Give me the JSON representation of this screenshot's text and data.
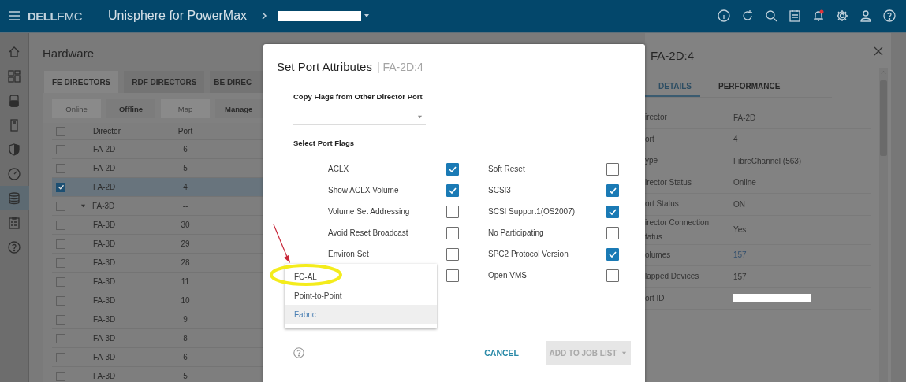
{
  "top_bar": {
    "brand": [
      "DELL",
      "EMC"
    ],
    "app_title": "Unisphere for PowerMax",
    "system_redacted": true
  },
  "sidebar": {
    "items": [
      {
        "selected": false
      },
      {
        "selected": false
      },
      {
        "selected": false
      },
      {
        "selected": false
      },
      {
        "selected": false
      },
      {
        "selected": false
      },
      {
        "selected": true
      },
      {
        "selected": false
      },
      {
        "selected": false
      }
    ]
  },
  "page": {
    "title": "Hardware",
    "tabs": [
      {
        "label": "FE DIRECTORS",
        "selected": true
      },
      {
        "label": "RDF DIRECTORS",
        "selected": false
      },
      {
        "label": "BE DIREC",
        "selected": false
      }
    ],
    "actions": [
      {
        "label": "Online",
        "disabled": true
      },
      {
        "label": "Offline",
        "disabled": false
      },
      {
        "label": "Map",
        "disabled": true
      },
      {
        "label": "Manage",
        "disabled": false
      }
    ],
    "table": {
      "columns": [
        "Director",
        "Port"
      ],
      "header_checked": false,
      "rows": [
        {
          "director": "FA-2D",
          "port": "6",
          "checked": false,
          "selected": false,
          "kind": "child"
        },
        {
          "director": "FA-2D",
          "port": "5",
          "checked": false,
          "selected": false,
          "kind": "child"
        },
        {
          "director": "FA-2D",
          "port": "4",
          "checked": true,
          "selected": true,
          "kind": "child"
        },
        {
          "director": "FA-3D",
          "port": "--",
          "checked": false,
          "selected": false,
          "kind": "group",
          "expanded": true
        },
        {
          "director": "FA-3D",
          "port": "30",
          "checked": false,
          "selected": false,
          "kind": "child"
        },
        {
          "director": "FA-3D",
          "port": "29",
          "checked": false,
          "selected": false,
          "kind": "child"
        },
        {
          "director": "FA-3D",
          "port": "28",
          "checked": false,
          "selected": false,
          "kind": "child"
        },
        {
          "director": "FA-3D",
          "port": "11",
          "checked": false,
          "selected": false,
          "kind": "child"
        },
        {
          "director": "FA-3D",
          "port": "10",
          "checked": false,
          "selected": false,
          "kind": "child"
        },
        {
          "director": "FA-3D",
          "port": "9",
          "checked": false,
          "selected": false,
          "kind": "child"
        },
        {
          "director": "FA-3D",
          "port": "8",
          "checked": false,
          "selected": false,
          "kind": "child"
        },
        {
          "director": "FA-3D",
          "port": "6",
          "checked": false,
          "selected": false,
          "kind": "child"
        },
        {
          "director": "FA-3D",
          "port": "5",
          "checked": false,
          "selected": false,
          "kind": "child"
        }
      ]
    }
  },
  "detail_panel": {
    "title": "FA-2D:4",
    "tabs": [
      {
        "label": "DETAILS",
        "selected": true
      },
      {
        "label": "PERFORMANCE",
        "selected": false
      }
    ],
    "rows": [
      {
        "label": "irector",
        "value": "FA-2D",
        "kind": "text"
      },
      {
        "label": "ort",
        "value": "4",
        "kind": "text"
      },
      {
        "label": "ype",
        "value": "FibreChannel (563)",
        "kind": "text"
      },
      {
        "label": "irector Status",
        "value": "Online",
        "kind": "text"
      },
      {
        "label": "ort Status",
        "value": "ON",
        "kind": "text"
      },
      {
        "label": "irector Connection tatus",
        "value": "Yes",
        "kind": "text"
      },
      {
        "label": "olumes",
        "value": "157",
        "kind": "link"
      },
      {
        "label": "lapped Devices",
        "value": "157",
        "kind": "text"
      },
      {
        "label": "ort ID",
        "kind": "redacted"
      }
    ]
  },
  "dialog": {
    "title": "Set Port Attributes",
    "subtitle": "| FA-2D:4",
    "copy_label": "Copy Flags from Other Director Port",
    "flags_label": "Select Port Flags",
    "flags_left": [
      {
        "label": "ACLX",
        "checked": true
      },
      {
        "label": "Show ACLX Volume",
        "checked": true
      },
      {
        "label": "Volume Set Addressing",
        "checked": false
      },
      {
        "label": "Avoid Reset Broadcast",
        "checked": false
      },
      {
        "label": "Environ Set",
        "checked": false
      },
      {
        "checked": false
      }
    ],
    "flags_right": [
      {
        "label": "Soft Reset",
        "checked": false
      },
      {
        "label": "SCSI3",
        "checked": true
      },
      {
        "label": "SCSI Support1(OS2007)",
        "checked": true
      },
      {
        "label": "No Participating",
        "checked": false
      },
      {
        "label": "SPC2 Protocol Version",
        "checked": true
      },
      {
        "label": "Open VMS",
        "checked": false
      }
    ],
    "menu": [
      {
        "label": "FC-AL",
        "selected": false
      },
      {
        "label": "Point-to-Point",
        "selected": false
      },
      {
        "label": "Fabric",
        "selected": true
      }
    ],
    "cancel": "CANCEL",
    "submit": {
      "label": "ADD TO JOB LIST",
      "disabled": true
    }
  },
  "annotations": {
    "arrow": true,
    "highlight": true
  }
}
